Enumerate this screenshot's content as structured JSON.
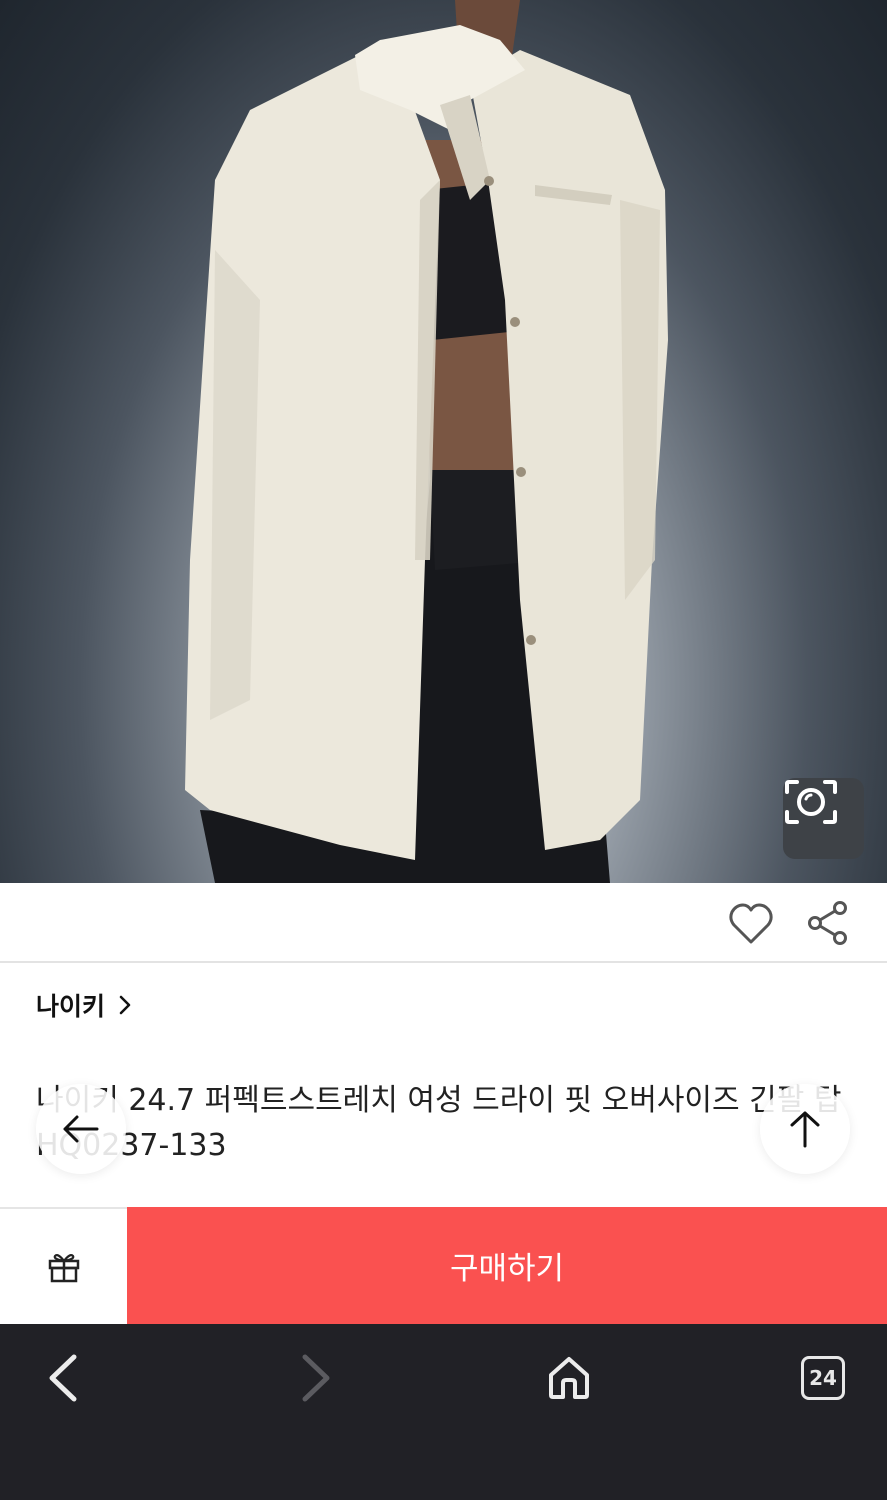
{
  "product": {
    "brand": "나이키",
    "title": "나이키 24.7 퍼펙트스트레치 여성 드라이 핏 오버사이즈 긴팔 탑 HQ0237-133"
  },
  "purchase": {
    "buy_label": "구매하기"
  },
  "browser": {
    "tab_count": "24"
  },
  "icons": {
    "visual_search": "camera-lens-scan-icon",
    "like": "heart-icon",
    "share": "share-icon",
    "brand_arrow": "chevron-right-icon",
    "back": "arrow-left-icon",
    "scroll_top": "arrow-up-icon",
    "gift": "gift-icon",
    "nav_back": "chevron-left-icon",
    "nav_forward": "chevron-right-icon",
    "home": "home-icon"
  },
  "colors": {
    "buy_button": "#fa5150",
    "nav_background": "#212126"
  }
}
